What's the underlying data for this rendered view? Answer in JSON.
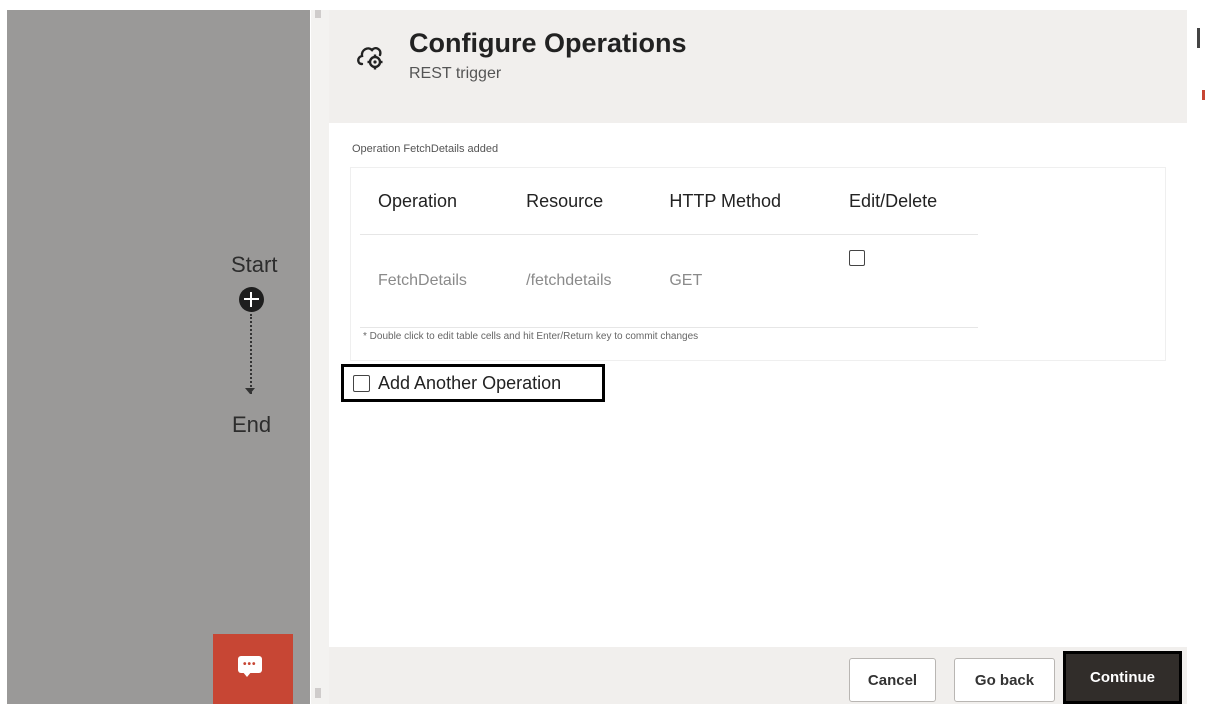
{
  "canvas": {
    "start_label": "Start",
    "end_label": "End"
  },
  "drawer": {
    "title": "Configure Operations",
    "subtitle": "REST trigger",
    "status_message": "Operation FetchDetails added",
    "table": {
      "headers": [
        "Operation",
        "Resource",
        "HTTP Method",
        "Edit/Delete"
      ],
      "rows": [
        {
          "operation": "FetchDetails",
          "resource": "/fetchdetails",
          "method": "GET",
          "edit_delete_checked": false
        }
      ],
      "hint": "* Double click to edit table cells and hit Enter/Return key to commit changes"
    },
    "add_another": {
      "label": "Add Another Operation",
      "checked": false
    },
    "footer": {
      "cancel_label": "Cancel",
      "go_back_label": "Go back",
      "continue_label": "Continue"
    }
  },
  "icons": {
    "header_icon": "cloud-gear-icon",
    "chat_icon": "chat-bubble-icon",
    "add_node_icon": "plus-circle-icon"
  },
  "colors": {
    "accent_red": "#c74634",
    "canvas_gray": "#9a9998",
    "header_bg": "#f1efed",
    "primary_button": "#312d2a"
  }
}
